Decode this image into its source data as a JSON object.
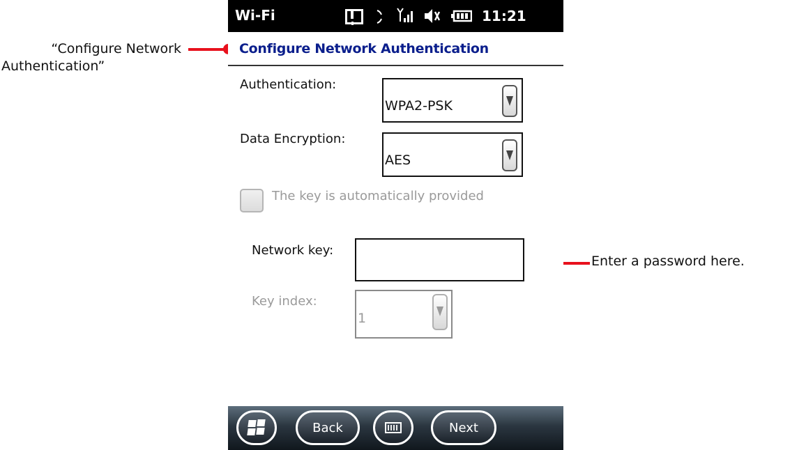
{
  "callouts": {
    "left_line1": "“Configure Network",
    "left_line2": "Authentication”",
    "right": "Enter a password here."
  },
  "status_bar": {
    "title": "Wi-Fi",
    "time": "11:21",
    "icons": [
      "sync-icon",
      "activity-arc-icon",
      "signal-icon",
      "volume-muted-icon",
      "battery-icon"
    ]
  },
  "header": {
    "title": "Configure Network Authentication"
  },
  "form": {
    "authentication": {
      "label": "Authentication:",
      "value": "WPA2-PSK"
    },
    "data_encryption": {
      "label": "Data Encryption:",
      "value": "AES"
    },
    "auto_key": {
      "label": "The key is automatically provided",
      "checked": false,
      "enabled": false
    },
    "network_key": {
      "label": "Network key:",
      "value": ""
    },
    "key_index": {
      "label": "Key index:",
      "value": "1",
      "enabled": false
    }
  },
  "bottom_bar": {
    "back_label": "Back",
    "next_label": "Next"
  },
  "colors": {
    "accent": "#e8111d",
    "header_title": "#0a1e8c"
  }
}
